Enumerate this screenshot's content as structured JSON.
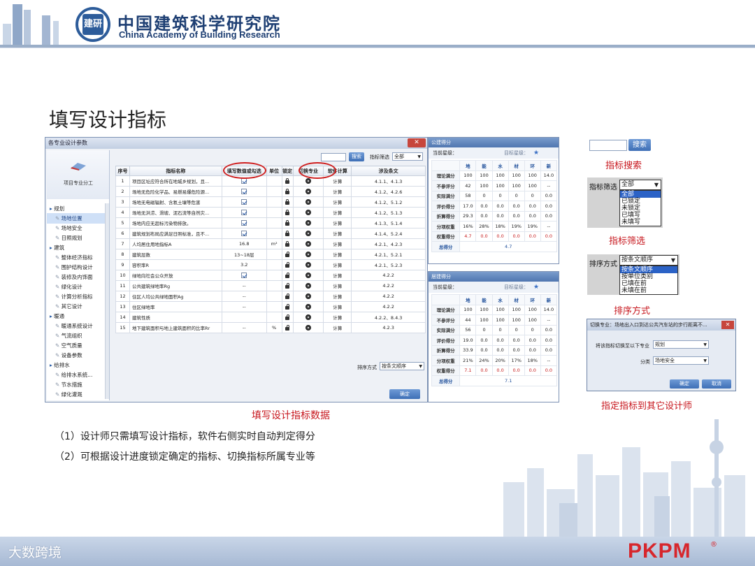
{
  "header": {
    "org_cn": "中国建筑科学研究院",
    "org_en": "China Academy of Building Research",
    "logo_text": "建研"
  },
  "page_title": "填写设计指标",
  "main_window": {
    "title": "各专业设计参数",
    "close_glyph": "✕",
    "sidebar": {
      "logo_label": "项目专业分工",
      "items": [
        {
          "label": "规划",
          "level": 0,
          "selected": false
        },
        {
          "label": "场地位置",
          "level": 1,
          "selected": true
        },
        {
          "label": "场地安全",
          "level": 1,
          "selected": false
        },
        {
          "label": "日照规划",
          "level": 1,
          "selected": false
        },
        {
          "label": "建筑",
          "level": 0,
          "selected": false
        },
        {
          "label": "整体经济指标",
          "level": 1,
          "selected": false
        },
        {
          "label": "围护结构设计",
          "level": 1,
          "selected": false
        },
        {
          "label": "装修及内饰面",
          "level": 1,
          "selected": false
        },
        {
          "label": "绿化设计",
          "level": 1,
          "selected": false
        },
        {
          "label": "计算分析指标",
          "level": 1,
          "selected": false
        },
        {
          "label": "其它设计",
          "level": 1,
          "selected": false
        },
        {
          "label": "暖通",
          "level": 0,
          "selected": false
        },
        {
          "label": "暖通系统设计",
          "level": 1,
          "selected": false
        },
        {
          "label": "气流组织",
          "level": 1,
          "selected": false
        },
        {
          "label": "空气质量",
          "level": 1,
          "selected": false
        },
        {
          "label": "设备参数",
          "level": 1,
          "selected": false
        },
        {
          "label": "给排水",
          "level": 0,
          "selected": false
        },
        {
          "label": "给排水系统...",
          "level": 1,
          "selected": false
        },
        {
          "label": "节水措施",
          "level": 1,
          "selected": false
        },
        {
          "label": "绿化灌溉",
          "level": 1,
          "selected": false
        }
      ]
    },
    "search_button": "搜索",
    "filter_label": "指标筛选",
    "filter_value": "全部",
    "columns": [
      "序号",
      "指标名称",
      "填写数值或勾选",
      "单位",
      "锁定",
      "切换专业",
      "软件计算",
      "涉及条文"
    ],
    "rows": [
      {
        "no": "1",
        "name": "项目区址应符合所在地城乡规划，且...",
        "value": "",
        "check": true,
        "unit": "",
        "locked": true,
        "calc": "计算",
        "clause": "4.1.1、4.1.3"
      },
      {
        "no": "2",
        "name": "场地无危险化学品、易燃易爆危险源...",
        "value": "",
        "check": true,
        "unit": "",
        "locked": true,
        "calc": "计算",
        "clause": "4.1.2、4.2.6"
      },
      {
        "no": "3",
        "name": "场地无电磁辐射、含氡土壤等危害",
        "value": "",
        "check": true,
        "unit": "",
        "locked": true,
        "calc": "计算",
        "clause": "4.1.2、5.1.2"
      },
      {
        "no": "4",
        "name": "场地无洪涝、滑坡、泥石流等自然灾...",
        "value": "",
        "check": true,
        "unit": "",
        "locked": true,
        "calc": "计算",
        "clause": "4.1.2、5.1.3"
      },
      {
        "no": "5",
        "name": "场地内应无超标污染物排放。",
        "value": "",
        "check": true,
        "unit": "",
        "locked": true,
        "calc": "计算",
        "clause": "4.1.3、5.1.4"
      },
      {
        "no": "6",
        "name": "建筑规划布局应满足日照标准，且不...",
        "value": "",
        "check": true,
        "unit": "",
        "locked": true,
        "calc": "计算",
        "clause": "4.1.4、5.2.4"
      },
      {
        "no": "7",
        "name": "人均居住用地指标A",
        "value": "16.8",
        "check": false,
        "unit": "m²",
        "locked": true,
        "calc": "计算",
        "clause": "4.2.1、4.2.3"
      },
      {
        "no": "8",
        "name": "建筑层数",
        "value": "13~18层",
        "check": false,
        "unit": "",
        "locked": false,
        "calc": "计算",
        "clause": "4.2.1、5.2.1"
      },
      {
        "no": "9",
        "name": "容积率R",
        "value": "3.2",
        "check": false,
        "unit": "",
        "locked": false,
        "calc": "计算",
        "clause": "4.2.1、5.2.3"
      },
      {
        "no": "10",
        "name": "绿地向社会公众开放",
        "value": "",
        "check": true,
        "unit": "",
        "locked": false,
        "calc": "计算",
        "clause": "4.2.2"
      },
      {
        "no": "11",
        "name": "公共建筑绿地率Rg",
        "value": "--",
        "check": false,
        "unit": "",
        "locked": false,
        "calc": "计算",
        "clause": "4.2.2"
      },
      {
        "no": "12",
        "name": "住区人均公共绿地面积Ag",
        "value": "--",
        "check": false,
        "unit": "",
        "locked": false,
        "calc": "计算",
        "clause": "4.2.2"
      },
      {
        "no": "13",
        "name": "住区绿地率",
        "value": "--",
        "check": false,
        "unit": "",
        "locked": false,
        "calc": "计算",
        "clause": "4.2.2"
      },
      {
        "no": "14",
        "name": "建筑性质",
        "value": "",
        "check": false,
        "unit": "",
        "locked": false,
        "calc": "计算",
        "clause": "4.2.2、8.4.3"
      },
      {
        "no": "15",
        "name": "地下建筑面积与地上建筑面积的比率Rr",
        "value": "--",
        "check": false,
        "unit": "%",
        "locked": false,
        "calc": "计算",
        "clause": "4.2.3"
      }
    ],
    "sort_label": "排序方式",
    "sort_value": "按条文顺序",
    "ok_button": "确定"
  },
  "score_public": {
    "title": "公建得分",
    "current_label": "当前星级：",
    "target_label": "目标星级：",
    "columns": [
      "",
      "地",
      "能",
      "水",
      "材",
      "环",
      "新"
    ],
    "rows": [
      {
        "label": "理论满分",
        "values": [
          "100",
          "100",
          "100",
          "100",
          "100",
          "14.0"
        ],
        "red": false
      },
      {
        "label": "不参评分",
        "values": [
          "42",
          "100",
          "100",
          "100",
          "100",
          "--"
        ],
        "red": false
      },
      {
        "label": "实际满分",
        "values": [
          "58",
          "0",
          "0",
          "0",
          "0",
          "0.0"
        ],
        "red": false
      },
      {
        "label": "评价得分",
        "values": [
          "17.0",
          "0.0",
          "0.0",
          "0.0",
          "0.0",
          "0.0"
        ],
        "red": false
      },
      {
        "label": "折算得分",
        "values": [
          "29.3",
          "0.0",
          "0.0",
          "0.0",
          "0.0",
          "0.0"
        ],
        "red": false
      },
      {
        "label": "分项权重",
        "values": [
          "16%",
          "28%",
          "18%",
          "19%",
          "19%",
          "--"
        ],
        "red": false
      },
      {
        "label": "权重得分",
        "values": [
          "4.7",
          "0.0",
          "0.0",
          "0.0",
          "0.0",
          "0.0"
        ],
        "red": true
      }
    ],
    "total_label": "总得分",
    "total_value": "4.7"
  },
  "score_res": {
    "title": "居建得分",
    "current_label": "当前星级：",
    "target_label": "目标星级：",
    "columns": [
      "",
      "地",
      "能",
      "水",
      "材",
      "环",
      "新"
    ],
    "rows": [
      {
        "label": "理论满分",
        "values": [
          "100",
          "100",
          "100",
          "100",
          "100",
          "14.0"
        ],
        "red": false
      },
      {
        "label": "不参评分",
        "values": [
          "44",
          "100",
          "100",
          "100",
          "100",
          "--"
        ],
        "red": false
      },
      {
        "label": "实际满分",
        "values": [
          "56",
          "0",
          "0",
          "0",
          "0",
          "0.0"
        ],
        "red": false
      },
      {
        "label": "评价得分",
        "values": [
          "19.0",
          "0.0",
          "0.0",
          "0.0",
          "0.0",
          "0.0"
        ],
        "red": false
      },
      {
        "label": "折算得分",
        "values": [
          "33.9",
          "0.0",
          "0.0",
          "0.0",
          "0.0",
          "0.0"
        ],
        "red": false
      },
      {
        "label": "分项权重",
        "values": [
          "21%",
          "24%",
          "20%",
          "17%",
          "18%",
          "--"
        ],
        "red": false
      },
      {
        "label": "权重得分",
        "values": [
          "7.1",
          "0.0",
          "0.0",
          "0.0",
          "0.0",
          "0.0"
        ],
        "red": true
      }
    ],
    "total_label": "总得分",
    "total_value": "7.1"
  },
  "demo_search": {
    "button": "搜索",
    "caption": "指标搜索"
  },
  "demo_filter": {
    "label": "指标筛选",
    "selected": "全部",
    "options": [
      "全部",
      "已锁定",
      "未锁定",
      "已填写",
      "未填写"
    ],
    "caption": "指标筛选"
  },
  "demo_sort": {
    "label": "排序方式",
    "selected": "按条文顺序",
    "options": [
      "按条文顺序",
      "按单位类别",
      "已填在前",
      "未填在前"
    ],
    "caption": "排序方式"
  },
  "demo_dialog": {
    "title": "切换专业：场地出入口到达公共汽车站的步行距离不...",
    "label_switch": "将该指标切换至以下专业",
    "switch_value": "规划",
    "label_category": "分类",
    "category_value": "场地安全",
    "ok": "确定",
    "cancel": "取消",
    "caption": "指定指标到其它设计师"
  },
  "caption_main": "填写设计指标数据",
  "notes": [
    "（1）设计师只需填写设计指标，软件右侧实时自动判定得分",
    "（2）可根据设计进度锁定确定的指标、切换指标所属专业等"
  ],
  "footer": {
    "watermark": "大数跨境",
    "brand": "PKPM",
    "brand_reg": "®"
  },
  "colors": {
    "accent_red": "#c7171e",
    "header_blue": "#1e3f73",
    "button_blue": "#3e6fb6"
  }
}
